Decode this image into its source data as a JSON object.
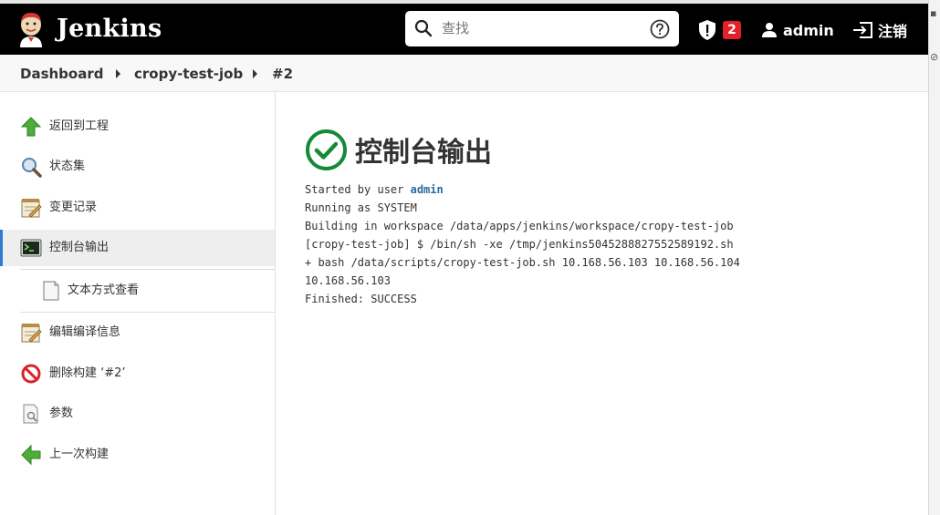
{
  "header": {
    "brand": "Jenkins",
    "search_placeholder": "查找",
    "security_count": "2",
    "user_name": "admin",
    "logout_label": "注销"
  },
  "breadcrumb": {
    "items": [
      "Dashboard",
      "cropy-test-job",
      "#2"
    ]
  },
  "sidebar": {
    "items": [
      {
        "label": "返回到工程",
        "icon": "up-arrow-icon"
      },
      {
        "label": "状态集",
        "icon": "magnifier-icon"
      },
      {
        "label": "变更记录",
        "icon": "notepad-icon"
      },
      {
        "label": "控制台输出",
        "icon": "terminal-icon",
        "active": true
      },
      {
        "label": "文本方式查看",
        "icon": "document-icon"
      },
      {
        "label": "编辑编译信息",
        "icon": "notepad-icon"
      },
      {
        "label": "删除构建 ‘#2’",
        "icon": "no-entry-icon"
      },
      {
        "label": "参数",
        "icon": "document-search-icon"
      },
      {
        "label": "上一次构建",
        "icon": "left-arrow-icon"
      }
    ]
  },
  "main": {
    "title": "控制台输出",
    "console": {
      "started_by_prefix": "Started by user ",
      "started_by_user": "admin",
      "lines": [
        "Running as SYSTEM",
        "Building in workspace /data/apps/jenkins/workspace/cropy-test-job",
        "[cropy-test-job] $ /bin/sh -xe /tmp/jenkins5045288827552589192.sh",
        "+ bash /data/scripts/cropy-test-job.sh 10.168.56.103 10.168.56.104",
        "10.168.56.103",
        "Finished: SUCCESS"
      ]
    }
  },
  "colors": {
    "header_bg": "#000000",
    "badge_red": "#e4202b",
    "success_green": "#138a36",
    "link_blue": "#2d6aa0",
    "active_accent": "#2e7bcf"
  }
}
